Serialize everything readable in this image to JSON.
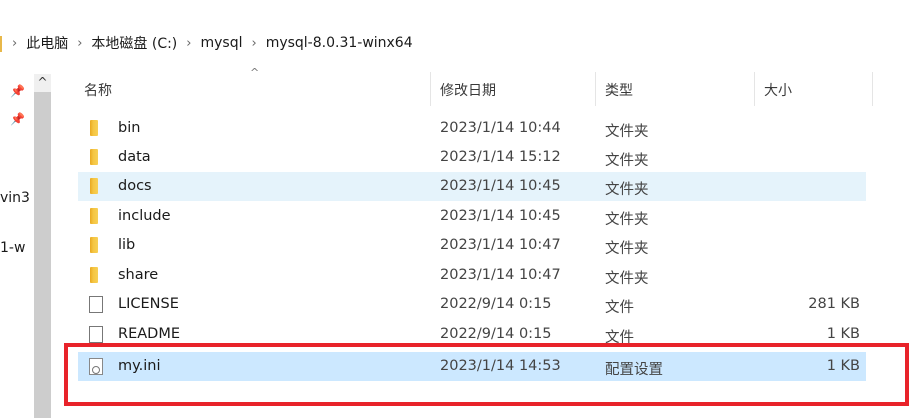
{
  "address_bar": {
    "crumbs": [
      "此电脑",
      "本地磁盘 (C:)",
      "mysql",
      "mysql-8.0.31-winx64"
    ]
  },
  "left_pane": {
    "truncated": [
      "vin3",
      "1-w"
    ]
  },
  "columns": {
    "name": "名称",
    "date": "修改日期",
    "type": "类型",
    "size": "大小"
  },
  "files": [
    {
      "name": "bin",
      "date": "2023/1/14 10:44",
      "type": "文件夹",
      "size": "",
      "icon": "folder-icon"
    },
    {
      "name": "data",
      "date": "2023/1/14 15:12",
      "type": "文件夹",
      "size": "",
      "icon": "folder-icon"
    },
    {
      "name": "docs",
      "date": "2023/1/14 10:45",
      "type": "文件夹",
      "size": "",
      "icon": "folder-icon"
    },
    {
      "name": "include",
      "date": "2023/1/14 10:45",
      "type": "文件夹",
      "size": "",
      "icon": "folder-icon"
    },
    {
      "name": "lib",
      "date": "2023/1/14 10:47",
      "type": "文件夹",
      "size": "",
      "icon": "folder-icon"
    },
    {
      "name": "share",
      "date": "2023/1/14 10:47",
      "type": "文件夹",
      "size": "",
      "icon": "folder-icon"
    },
    {
      "name": "LICENSE",
      "date": "2022/9/14 0:15",
      "type": "文件",
      "size": "281 KB",
      "icon": "file-icon"
    },
    {
      "name": "README",
      "date": "2022/9/14 0:15",
      "type": "文件",
      "size": "1 KB",
      "icon": "file-icon"
    },
    {
      "name": "my.ini",
      "date": "2023/1/14 14:53",
      "type": "配置设置",
      "size": "1 KB",
      "icon": "config-file-icon"
    }
  ],
  "colors": {
    "hover_row": "#e5f3fb",
    "selected_row": "#cce8ff",
    "annotation_box": "#e8232a"
  }
}
